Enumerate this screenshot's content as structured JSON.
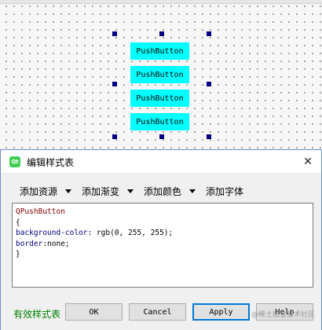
{
  "canvas": {
    "buttons": [
      {
        "label": "PushButton"
      },
      {
        "label": "PushButton"
      },
      {
        "label": "PushButton"
      },
      {
        "label": "PushButton"
      }
    ],
    "button_color": "#00ffff",
    "handle_color": "#000080"
  },
  "dialog": {
    "icon_text": "Qt",
    "title": "编辑样式表",
    "close_symbol": "✕",
    "toolbar": {
      "add_resource": "添加资源",
      "add_gradient": "添加渐变",
      "add_color": "添加颜色",
      "add_font": "添加字体"
    },
    "editor": {
      "line1": "QPushButton",
      "line2": "{",
      "line3_prop": "background-color",
      "line3_val": ": rgb(0, 255, 255);",
      "line4_prop": "border",
      "line4_val": ":none;",
      "line5": "}"
    },
    "status": "有效样式表",
    "buttons": {
      "ok": "OK",
      "cancel": "Cancel",
      "apply": "Apply",
      "help": "Help"
    },
    "watermark": "@稀土掘金技术社区"
  }
}
